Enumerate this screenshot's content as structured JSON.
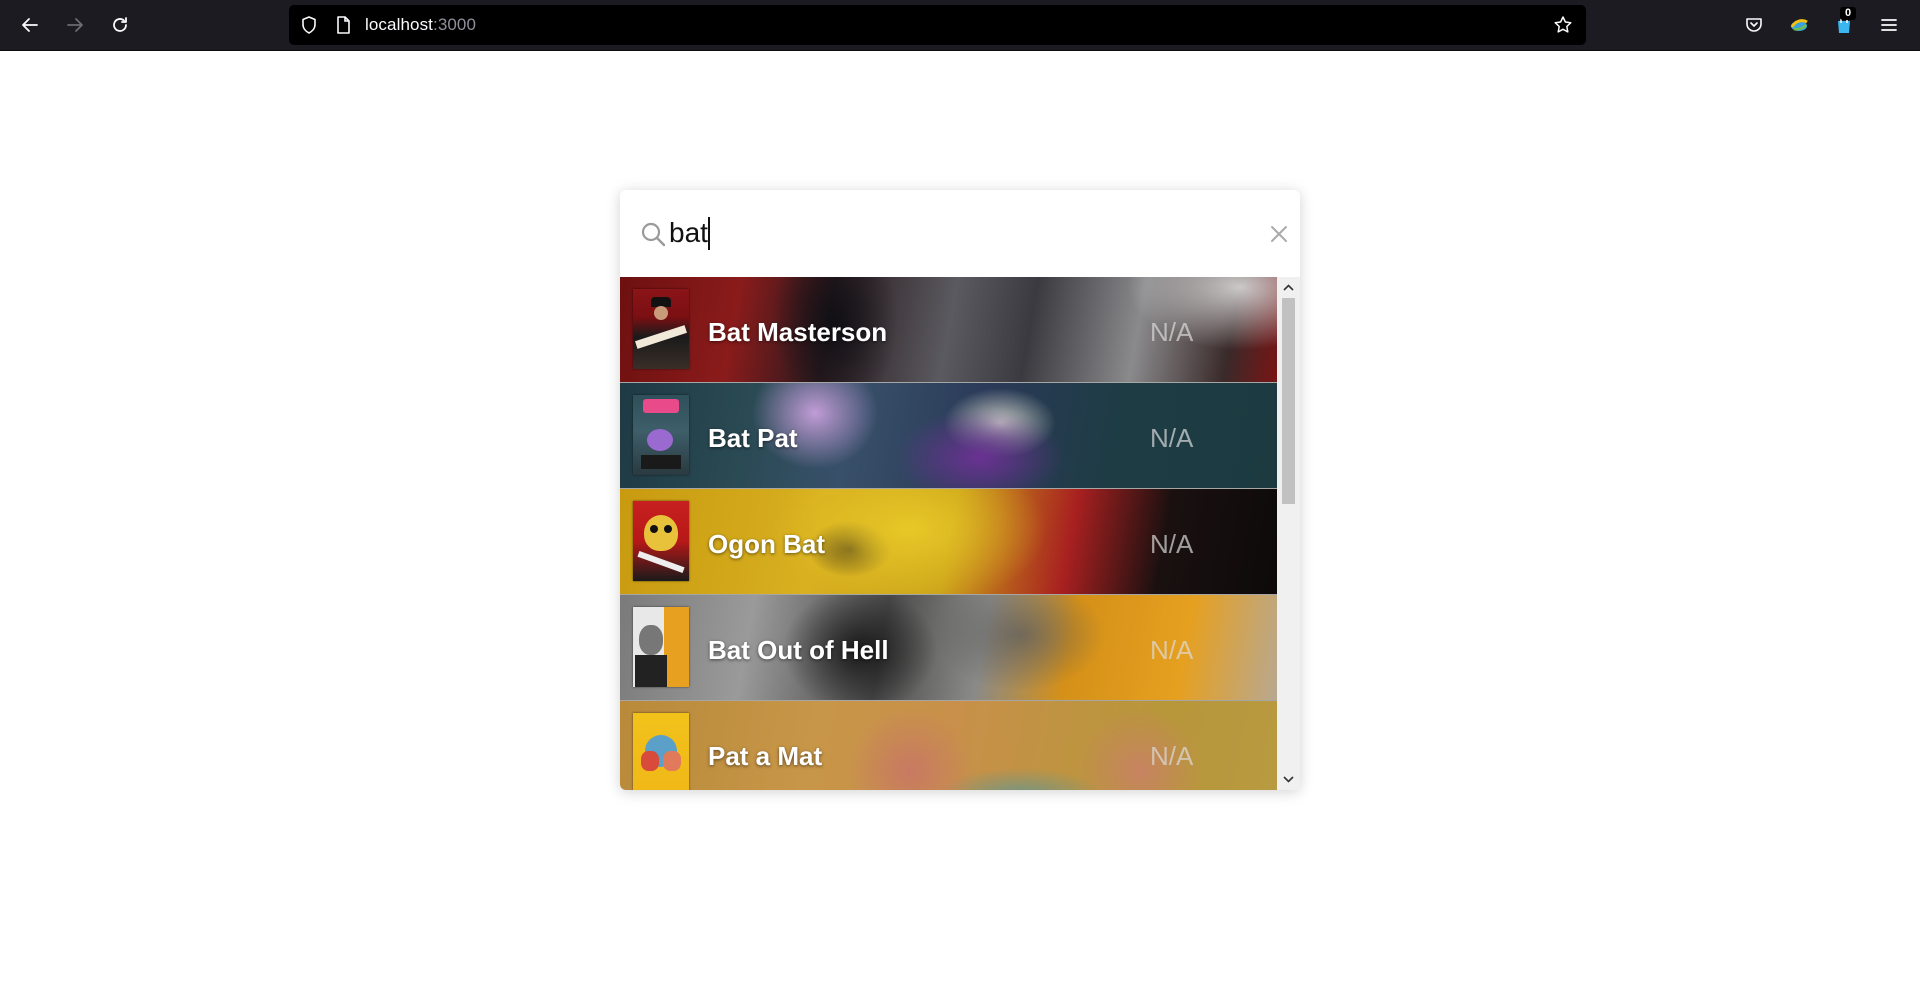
{
  "browser": {
    "url_host": "localhost",
    "url_port": ":3000",
    "extension_badge": "0"
  },
  "search": {
    "query": "bat",
    "placeholder": ""
  },
  "results": [
    {
      "title": "Bat Masterson",
      "rating": "N/A"
    },
    {
      "title": "Bat Pat",
      "rating": "N/A"
    },
    {
      "title": "Ogon Bat",
      "rating": "N/A"
    },
    {
      "title": "Bat Out of Hell",
      "rating": "N/A"
    },
    {
      "title": "Pat a Mat",
      "rating": "N/A"
    }
  ],
  "colors": {
    "toolbar": "#1c1b22",
    "urlbar": "#000000"
  }
}
